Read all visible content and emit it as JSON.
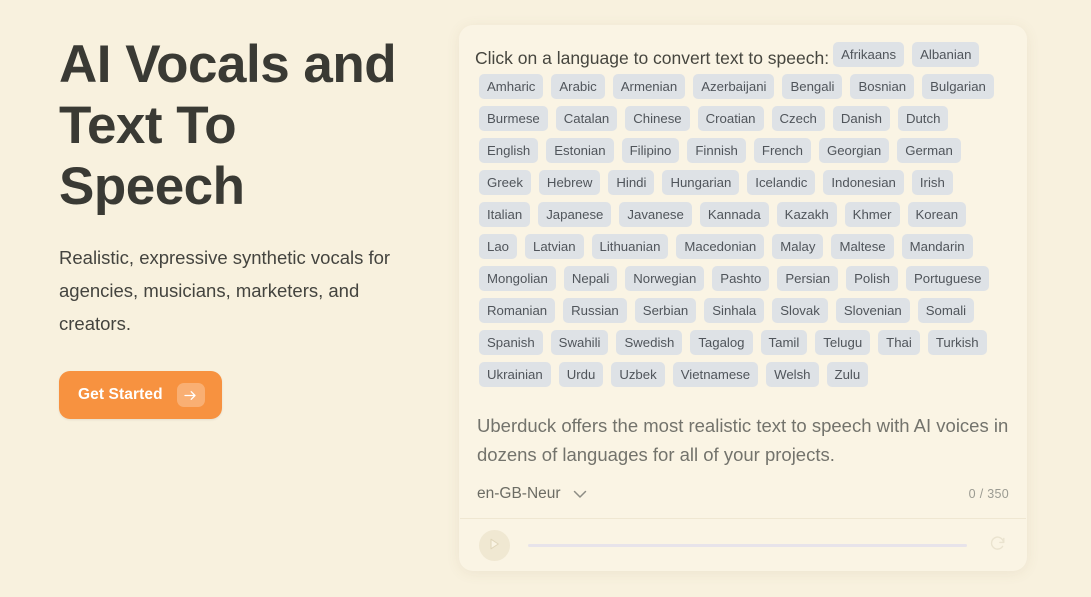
{
  "hero": {
    "title": "AI Vocals and Text To Speech",
    "subtitle": "Realistic, expressive synthetic vocals for agencies, musicians, marketers, and creators.",
    "cta_label": "Get Started",
    "cta_icon": "arrow-right-icon"
  },
  "card": {
    "prompt": "Click on a language to convert text to speech:",
    "description": "Uberduck offers the most realistic text to speech with AI voices in dozens of languages for all of your projects.",
    "languages": [
      "Afrikaans",
      "Albanian",
      "Amharic",
      "Arabic",
      "Armenian",
      "Azerbaijani",
      "Bengali",
      "Bosnian",
      "Bulgarian",
      "Burmese",
      "Catalan",
      "Chinese",
      "Croatian",
      "Czech",
      "Danish",
      "Dutch",
      "English",
      "Estonian",
      "Filipino",
      "Finnish",
      "French",
      "Georgian",
      "German",
      "Greek",
      "Hebrew",
      "Hindi",
      "Hungarian",
      "Icelandic",
      "Indonesian",
      "Irish",
      "Italian",
      "Japanese",
      "Javanese",
      "Kannada",
      "Kazakh",
      "Khmer",
      "Korean",
      "Lao",
      "Latvian",
      "Lithuanian",
      "Macedonian",
      "Malay",
      "Maltese",
      "Mandarin",
      "Mongolian",
      "Nepali",
      "Norwegian",
      "Pashto",
      "Persian",
      "Polish",
      "Portuguese",
      "Romanian",
      "Russian",
      "Serbian",
      "Sinhala",
      "Slovak",
      "Slovenian",
      "Somali",
      "Spanish",
      "Swahili",
      "Swedish",
      "Tagalog",
      "Tamil",
      "Telugu",
      "Thai",
      "Turkish",
      "Ukrainian",
      "Urdu",
      "Uzbek",
      "Vietnamese",
      "Welsh",
      "Zulu"
    ],
    "voice_selected": "en-GB-Neur",
    "voice_chevron_icon": "chevron-down-icon",
    "char_count": "0 / 350",
    "player": {
      "play_icon": "play-icon",
      "refresh_icon": "refresh-icon",
      "progress_percent": 0
    }
  },
  "colors": {
    "page_bg": "#f8f1de",
    "card_bg": "#faf4e4",
    "accent": "#f79240",
    "chip_bg": "#dee2e6",
    "text_dark": "#3a3a34",
    "text_muted": "#73736c"
  }
}
